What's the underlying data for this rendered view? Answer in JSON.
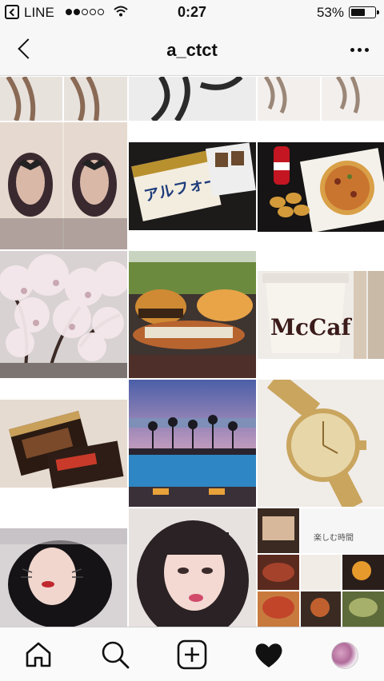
{
  "status_bar": {
    "carrier": "LINE",
    "time": "0:27",
    "battery_percent": "53%",
    "battery_level": 0.53,
    "signal_bars_filled": 2,
    "signal_bars_total": 5
  },
  "nav": {
    "title": "a_ctct"
  },
  "grid": {
    "posts": [
      {
        "subject": "hair-photo-collage"
      },
      {
        "subject": "black-white-hair-portrait"
      },
      {
        "subject": "wavy-hair-collage"
      },
      {
        "subject": "butterfly-mask-selfie-collage"
      },
      {
        "subject": "alfort-chocolate-box",
        "caption": "アルフォート"
      },
      {
        "subject": "pizza-nuggets-cola"
      },
      {
        "subject": "cherry-blossoms"
      },
      {
        "subject": "burger-and-hotdog"
      },
      {
        "subject": "mccafe-cup",
        "caption": "McCaf"
      },
      {
        "subject": "chocolate-snack-box"
      },
      {
        "subject": "sunset-pool"
      },
      {
        "subject": "gold-wristwatch"
      },
      {
        "subject": "selfie-with-filter"
      },
      {
        "subject": "selfie-portrait"
      },
      {
        "subject": "food-collage",
        "caption": "楽しむ時間"
      }
    ]
  },
  "tab_bar": {
    "tabs": [
      "home",
      "search",
      "new-post",
      "activity",
      "profile"
    ]
  },
  "colors": {
    "bar_background": "#f7f7f7",
    "icon_color": "#111111"
  }
}
